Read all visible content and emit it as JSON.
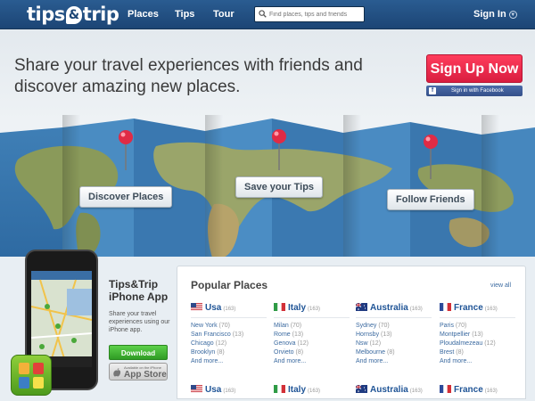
{
  "nav": {
    "logo_left": "tips",
    "logo_amp": "&",
    "logo_right": "trip",
    "links": [
      "Places",
      "Tips",
      "Tour"
    ],
    "search_placeholder": "Find places, tips and friends",
    "signin": "Sign In"
  },
  "hero": {
    "headline_line1": "Share your travel experiences with friends and",
    "headline_line2": "discover amazing new places.",
    "signup": "Sign Up Now",
    "facebook": "Sign in with Facebook",
    "callouts": [
      "Discover Places",
      "Save your Tips",
      "Follow Friends"
    ]
  },
  "app": {
    "title_line1": "Tips&Trip",
    "title_line2": "iPhone App",
    "desc": "Share your travel experiences using our iPhone app.",
    "download": "Download",
    "appstore_small": "Available on the iPhone",
    "appstore_big": "App Store"
  },
  "popular": {
    "title": "Popular Places",
    "view_all": "view all",
    "countries": [
      {
        "name": "Usa",
        "count": "(163)",
        "flag": "usa",
        "cities": [
          {
            "name": "New York",
            "n": "(70)"
          },
          {
            "name": "San Francisco",
            "n": "(13)"
          },
          {
            "name": "Chicago",
            "n": "(12)"
          },
          {
            "name": "Brooklyn",
            "n": "(8)"
          },
          {
            "name": "And more...",
            "n": ""
          }
        ]
      },
      {
        "name": "Italy",
        "count": "(163)",
        "flag": "italy",
        "cities": [
          {
            "name": "Milan",
            "n": "(70)"
          },
          {
            "name": "Rome",
            "n": "(13)"
          },
          {
            "name": "Genova",
            "n": "(12)"
          },
          {
            "name": "Orvieto",
            "n": "(8)"
          },
          {
            "name": "And more...",
            "n": ""
          }
        ]
      },
      {
        "name": "Australia",
        "count": "(163)",
        "flag": "australia",
        "cities": [
          {
            "name": "Sydney",
            "n": "(70)"
          },
          {
            "name": "Hornsby",
            "n": "(13)"
          },
          {
            "name": "Nsw",
            "n": "(12)"
          },
          {
            "name": "Melbourne",
            "n": "(8)"
          },
          {
            "name": "And more...",
            "n": ""
          }
        ]
      },
      {
        "name": "France",
        "count": "(163)",
        "flag": "france",
        "cities": [
          {
            "name": "Paris",
            "n": "(70)"
          },
          {
            "name": "Montpellier",
            "n": "(13)"
          },
          {
            "name": "Ploudalmezeau",
            "n": "(12)"
          },
          {
            "name": "Brest",
            "n": "(8)"
          },
          {
            "name": "And more...",
            "n": ""
          }
        ]
      }
    ],
    "second_row": [
      {
        "name": "Usa",
        "count": "(163)",
        "flag": "usa"
      },
      {
        "name": "Italy",
        "count": "(163)",
        "flag": "italy"
      },
      {
        "name": "Australia",
        "count": "(163)",
        "flag": "australia"
      },
      {
        "name": "France",
        "count": "(163)",
        "flag": "france"
      }
    ]
  },
  "colors": {
    "nav_bg": "#1c4575",
    "signup": "#e8274b",
    "facebook": "#3b5998",
    "link": "#1f5496",
    "download": "#3aac2b"
  }
}
